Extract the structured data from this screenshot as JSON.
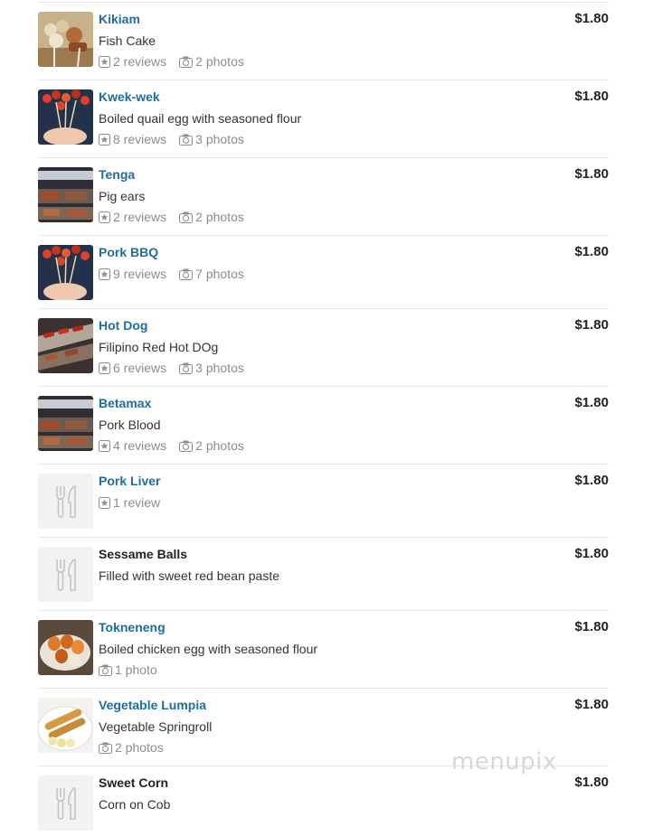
{
  "menu_items": [
    {
      "name": "Kikiam",
      "description": "Fish Cake",
      "reviews": "2 reviews",
      "photos": "2 photos",
      "price": "$1.80",
      "thumbnail": "skewered-fishballs"
    },
    {
      "name": "Kwek-wek",
      "description": "Boiled quail egg with seasoned flour",
      "reviews": "8 reviews",
      "photos": "3 photos",
      "price": "$1.80",
      "thumbnail": "skewers-in-hand"
    },
    {
      "name": "Tenga",
      "description": "Pig ears",
      "reviews": "2 reviews",
      "photos": "2 photos",
      "price": "$1.80",
      "thumbnail": "grill-stall"
    },
    {
      "name": "Pork BBQ",
      "description": "",
      "reviews": "9 reviews",
      "photos": "7 photos",
      "price": "$1.80",
      "thumbnail": "skewers-in-hand"
    },
    {
      "name": "Hot Dog",
      "description": "Filipino Red Hot DOg",
      "reviews": "6 reviews",
      "photos": "3 photos",
      "price": "$1.80",
      "thumbnail": "grill-tray"
    },
    {
      "name": "Betamax",
      "description": "Pork Blood",
      "reviews": "4 reviews",
      "photos": "2 photos",
      "price": "$1.80",
      "thumbnail": "grill-stall"
    },
    {
      "name": "Pork Liver",
      "description": "",
      "reviews": "1 review",
      "photos": "",
      "price": "$1.80",
      "thumbnail": "fork-knife-placeholder"
    },
    {
      "name": "Sessame Balls",
      "description": "Filled with sweet red bean paste",
      "reviews": "",
      "photos": "",
      "price": "$1.80",
      "thumbnail": "fork-knife-placeholder"
    },
    {
      "name": "Tokneneng",
      "description": "Boiled chicken egg with seasoned flour",
      "reviews": "",
      "photos": "1 photo",
      "price": "$1.80",
      "thumbnail": "egg-plate"
    },
    {
      "name": "Vegetable Lumpia",
      "description": "Vegetable Springroll",
      "reviews": "",
      "photos": "2 photos",
      "price": "$1.80",
      "thumbnail": "spring-rolls"
    },
    {
      "name": "Sweet Corn",
      "description": "Corn on Cob",
      "reviews": "",
      "photos": "",
      "price": "$1.80",
      "thumbnail": "fork-knife-placeholder"
    }
  ],
  "watermark": "menupix",
  "colors": {
    "link": "#1e6da1",
    "meta": "#8c8c8c",
    "divider": "#e6e6e6"
  }
}
